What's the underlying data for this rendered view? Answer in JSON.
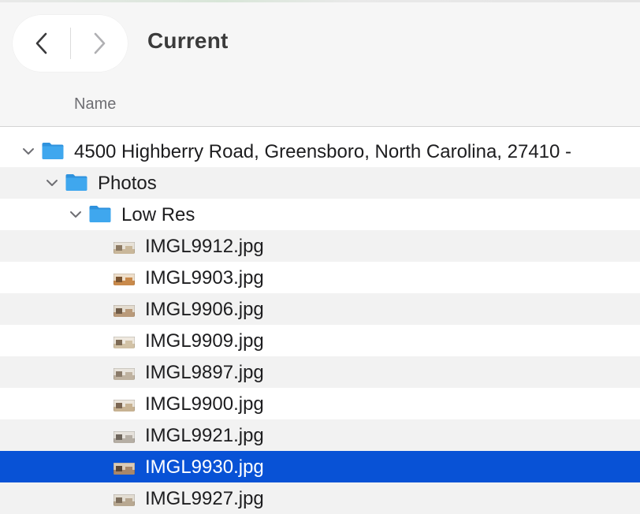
{
  "toolbar": {
    "title": "Current",
    "back_icon": "chevron-left-icon",
    "forward_icon": "chevron-right-icon"
  },
  "list_header": {
    "name_column": "Name"
  },
  "colors": {
    "selection": "#0852d6",
    "folder": "#3fa7ee",
    "alt_row": "#f2f2f2"
  },
  "rows": [
    {
      "label": "4500 Highberry Road, Greensboro, North Carolina, 27410 - ",
      "kind": "folder",
      "expanded": true,
      "depth": 0
    },
    {
      "label": "Photos",
      "kind": "folder",
      "expanded": true,
      "depth": 1
    },
    {
      "label": "Low Res",
      "kind": "folder",
      "expanded": true,
      "depth": 2
    },
    {
      "label": "IMGL9912.jpg",
      "kind": "image",
      "depth": 3
    },
    {
      "label": "IMGL9903.jpg",
      "kind": "image",
      "depth": 3
    },
    {
      "label": "IMGL9906.jpg",
      "kind": "image",
      "depth": 3
    },
    {
      "label": "IMGL9909.jpg",
      "kind": "image",
      "depth": 3
    },
    {
      "label": "IMGL9897.jpg",
      "kind": "image",
      "depth": 3
    },
    {
      "label": "IMGL9900.jpg",
      "kind": "image",
      "depth": 3
    },
    {
      "label": "IMGL9921.jpg",
      "kind": "image",
      "depth": 3
    },
    {
      "label": "IMGL9930.jpg",
      "kind": "image",
      "depth": 3,
      "selected": true
    },
    {
      "label": "IMGL9927.jpg",
      "kind": "image",
      "depth": 3
    }
  ]
}
